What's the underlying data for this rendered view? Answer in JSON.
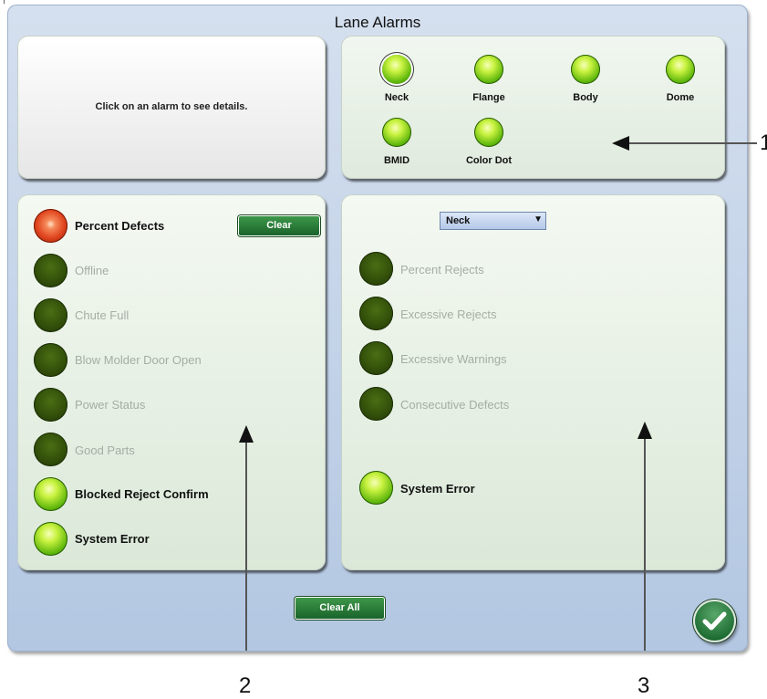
{
  "window": {
    "title": "Lane Alarms"
  },
  "info": {
    "text": "Click on an alarm to see details."
  },
  "top_alarms": [
    {
      "label": "Neck",
      "state": "green",
      "selected": true
    },
    {
      "label": "Flange",
      "state": "green",
      "selected": false
    },
    {
      "label": "Body",
      "state": "green",
      "selected": false
    },
    {
      "label": "Dome",
      "state": "green",
      "selected": false
    },
    {
      "label": "BMID",
      "state": "green",
      "selected": false
    },
    {
      "label": "Color Dot",
      "state": "green",
      "selected": false
    }
  ],
  "lane_alarms": {
    "clear_label": "Clear",
    "items": [
      {
        "label": "Percent Defects",
        "state": "red",
        "active": true
      },
      {
        "label": "Offline",
        "state": "dark",
        "active": false
      },
      {
        "label": "Chute Full",
        "state": "dark",
        "active": false
      },
      {
        "label": "Blow Molder Door Open",
        "state": "dark",
        "active": false
      },
      {
        "label": "Power Status",
        "state": "dark",
        "active": false
      },
      {
        "label": "Good Parts",
        "state": "dark",
        "active": false
      },
      {
        "label": "Blocked Reject Confirm",
        "state": "green",
        "active": true
      },
      {
        "label": "System Error",
        "state": "green",
        "active": true
      }
    ]
  },
  "station_alarms": {
    "selected": "Neck",
    "items": [
      {
        "label": "Percent Rejects",
        "state": "dark",
        "active": false
      },
      {
        "label": "Excessive Rejects",
        "state": "dark",
        "active": false
      },
      {
        "label": "Excessive Warnings",
        "state": "dark",
        "active": false
      },
      {
        "label": "Consecutive Defects",
        "state": "dark",
        "active": false
      },
      {
        "label": "System Error",
        "state": "green",
        "active": true
      }
    ]
  },
  "footer": {
    "clear_all_label": "Clear All"
  },
  "callouts": [
    "1",
    "2",
    "3"
  ],
  "colors": {
    "alarm_green": "#7fd11a",
    "alarm_red": "#e0451e",
    "button_green": "#2a7d39"
  }
}
